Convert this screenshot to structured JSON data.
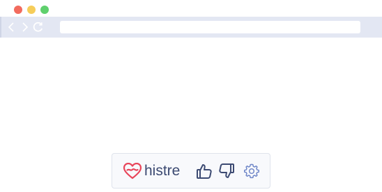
{
  "window": {
    "controls": [
      "close",
      "minimize",
      "maximize"
    ]
  },
  "navbar": {
    "back_icon": "chevron-left-icon",
    "forward_icon": "chevron-right-icon",
    "reload_icon": "reload-icon",
    "address_value": ""
  },
  "widget": {
    "brand_icon": "heart-logo-icon",
    "brand_name": "histre",
    "actions": [
      "thumbs-up-icon",
      "thumbs-down-icon",
      "gear-icon"
    ],
    "colors": {
      "brand_heart": "#e8455a",
      "icon_blue": "#3c4a72",
      "gear": "#6f86c8"
    }
  }
}
